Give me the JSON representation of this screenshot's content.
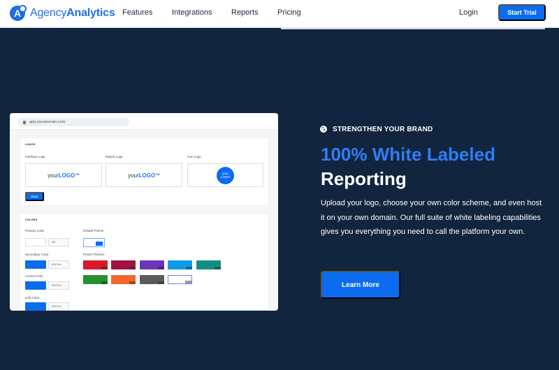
{
  "nav": {
    "logo_prefix": "Agency",
    "logo_suffix": "Analytics",
    "links": [
      "Features",
      "Integrations",
      "Reports",
      "Pricing"
    ],
    "login": "Login",
    "start_trial": "Start Trial"
  },
  "mockup": {
    "url": "app.yourdomain.com",
    "logos": {
      "title": "LOGOS",
      "interface_label": "Interface Logo",
      "report_label": "Report Logo",
      "icon_label": "Icon Logo",
      "logo_prefix": "your",
      "logo_emphasis": "LOGO",
      "logo_mark": "™",
      "icon_line_1": "your",
      "icon_line_2": "LOGO",
      "save": "Save"
    },
    "colors": {
      "title": "COLORS",
      "primary_label": "Primary Color",
      "primary_value": "#fff",
      "secondary_label": "Secondary Color",
      "secondary_value": "#0072ee",
      "accent_label": "Accent Color",
      "accent_value": "#0072ee",
      "link_label": "Link Color",
      "link_value": "#0072ee",
      "default_theme_label": "Default Theme",
      "preset_label": "Preset Themes",
      "theme_colors": [
        "#d7192a",
        "#a11343",
        "#6b35b7",
        "#0d9be8",
        "#148e82",
        "#26912e",
        "#f4672b",
        "#5b5b5b",
        "#ffffff"
      ]
    }
  },
  "hero": {
    "eyebrow": "STRENGTHEN YOUR BRAND",
    "headline_blue": "100% White Labeled",
    "headline_white": "Reporting",
    "description": "Upload your logo, choose your own color scheme, and even host it on your own domain. Our full suite of white labeling capabilities gives you everything you need to call the platform your own.",
    "cta": "Learn More"
  },
  "theme": {
    "accent": "#0b6cf0",
    "background": "#12253e"
  }
}
